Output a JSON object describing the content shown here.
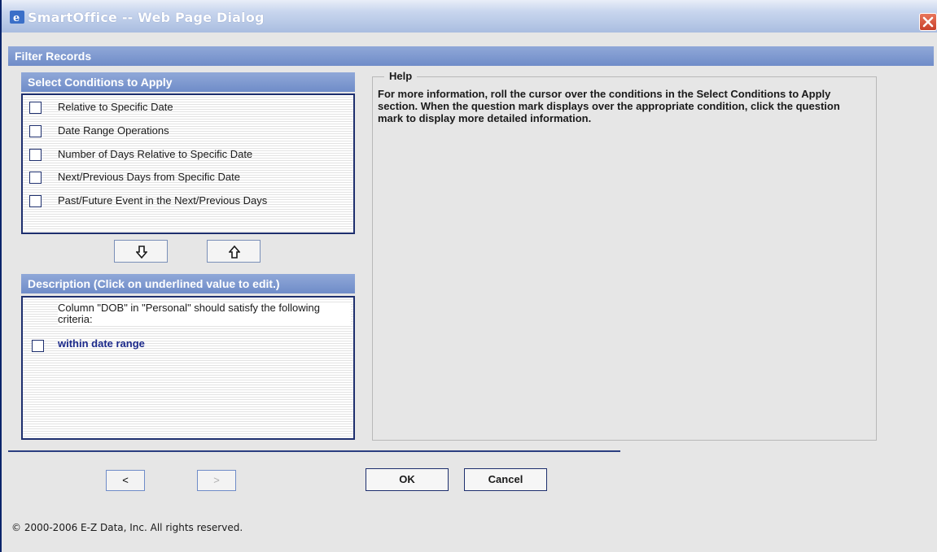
{
  "window": {
    "title": "SmartOffice -- Web Page Dialog"
  },
  "dialog": {
    "title": "Filter Records"
  },
  "conditions": {
    "header": "Select Conditions to Apply",
    "items": [
      {
        "label": "Relative to Specific Date",
        "checked": false
      },
      {
        "label": "Date Range Operations",
        "checked": false
      },
      {
        "label": "Number of Days Relative to Specific Date",
        "checked": false
      },
      {
        "label": "Next/Previous Days from Specific Date",
        "checked": false
      },
      {
        "label": "Past/Future Event in the Next/Previous Days",
        "checked": false
      }
    ]
  },
  "move_buttons": {
    "down_icon": "arrow-down-icon",
    "up_icon": "arrow-up-icon"
  },
  "description": {
    "header": "Description (Click on underlined value to edit.)",
    "text": "Column \"DOB\" in \"Personal\" should satisfy the following criteria:",
    "criteria": [
      {
        "label": "within date range",
        "checked": false
      }
    ]
  },
  "help": {
    "legend": "Help",
    "text": "For more information, roll the cursor over the conditions in the Select Conditions to Apply section. When the question mark displays over the appropriate condition, click the question mark to display more detailed information."
  },
  "footer": {
    "prev_label": "<",
    "next_label": ">",
    "ok_label": "OK",
    "cancel_label": "Cancel",
    "copyright": "© 2000-2006 E-Z Data, Inc. All rights reserved."
  },
  "colors": {
    "header_bg": "#7f9ad0",
    "border": "#1e2f6e",
    "link": "#1c2a8a"
  }
}
